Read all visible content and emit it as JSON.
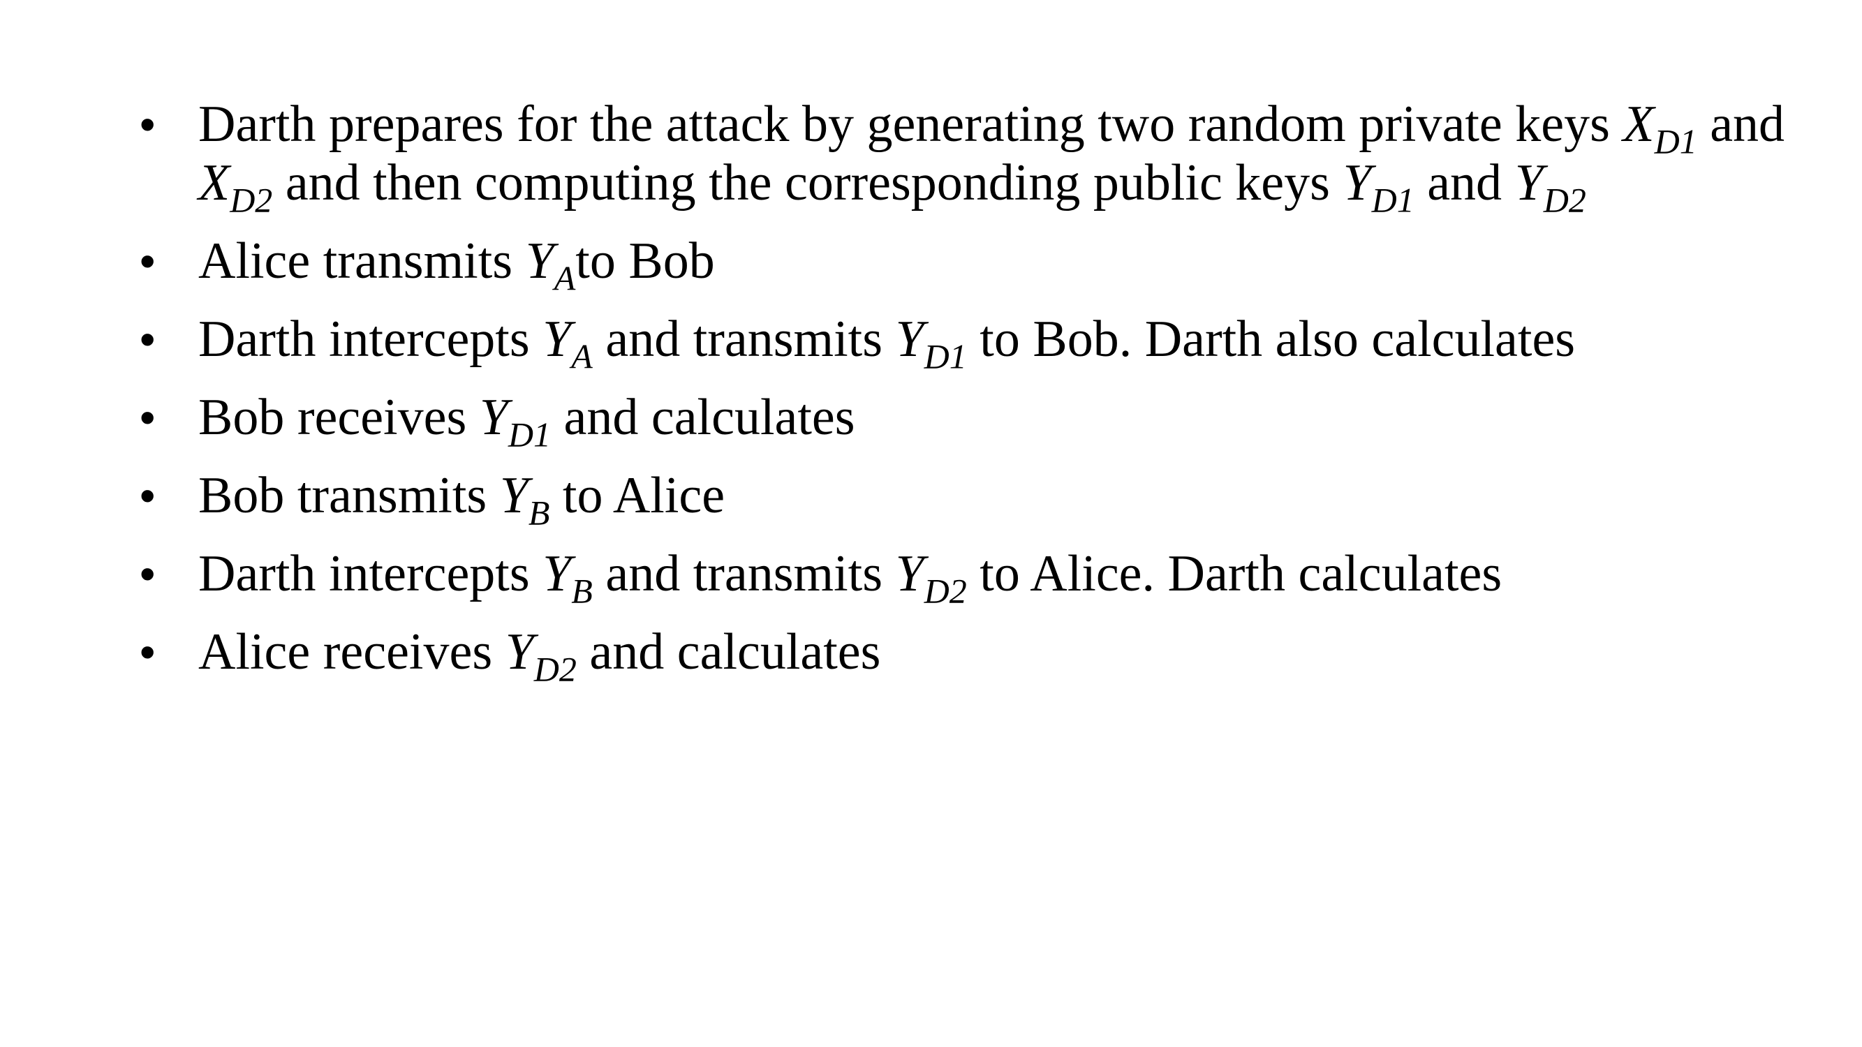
{
  "bullet_symbol": "•",
  "items": [
    {
      "t1": "Darth prepares for the attack by generating two random private keys ",
      "v1": "X",
      "s1": "D1",
      "t2": " and ",
      "v2": "X",
      "s2": "D2",
      "t3": " and then computing the corresponding public keys ",
      "v3": "Y",
      "s3": "D1",
      "t4": " and ",
      "v4": "Y",
      "s4": "D2"
    },
    {
      "t1": "Alice transmits ",
      "v1": "Y",
      "s1": "A",
      "t2": "to Bob"
    },
    {
      "t1": "Darth intercepts ",
      "v1": "Y",
      "s1": "A",
      "t2": " and transmits ",
      "v2": "Y",
      "s2": "D1",
      "t3": " to Bob. Darth also calculates"
    },
    {
      "t1": "Bob receives ",
      "v1": "Y",
      "s1": "D1",
      "t2": " and calculates"
    },
    {
      "t1": "Bob transmits ",
      "v1": "Y",
      "s1": "B",
      "t2": " to Alice"
    },
    {
      "t1": "Darth intercepts ",
      "v1": "Y",
      "s1": "B",
      "t2": " and transmits ",
      "v2": "Y",
      "s2": "D2",
      "t3": " to Alice. Darth calculates"
    },
    {
      "t1": "Alice receives ",
      "v1": "Y",
      "s1": "D2",
      "t2": " and calculates"
    }
  ]
}
